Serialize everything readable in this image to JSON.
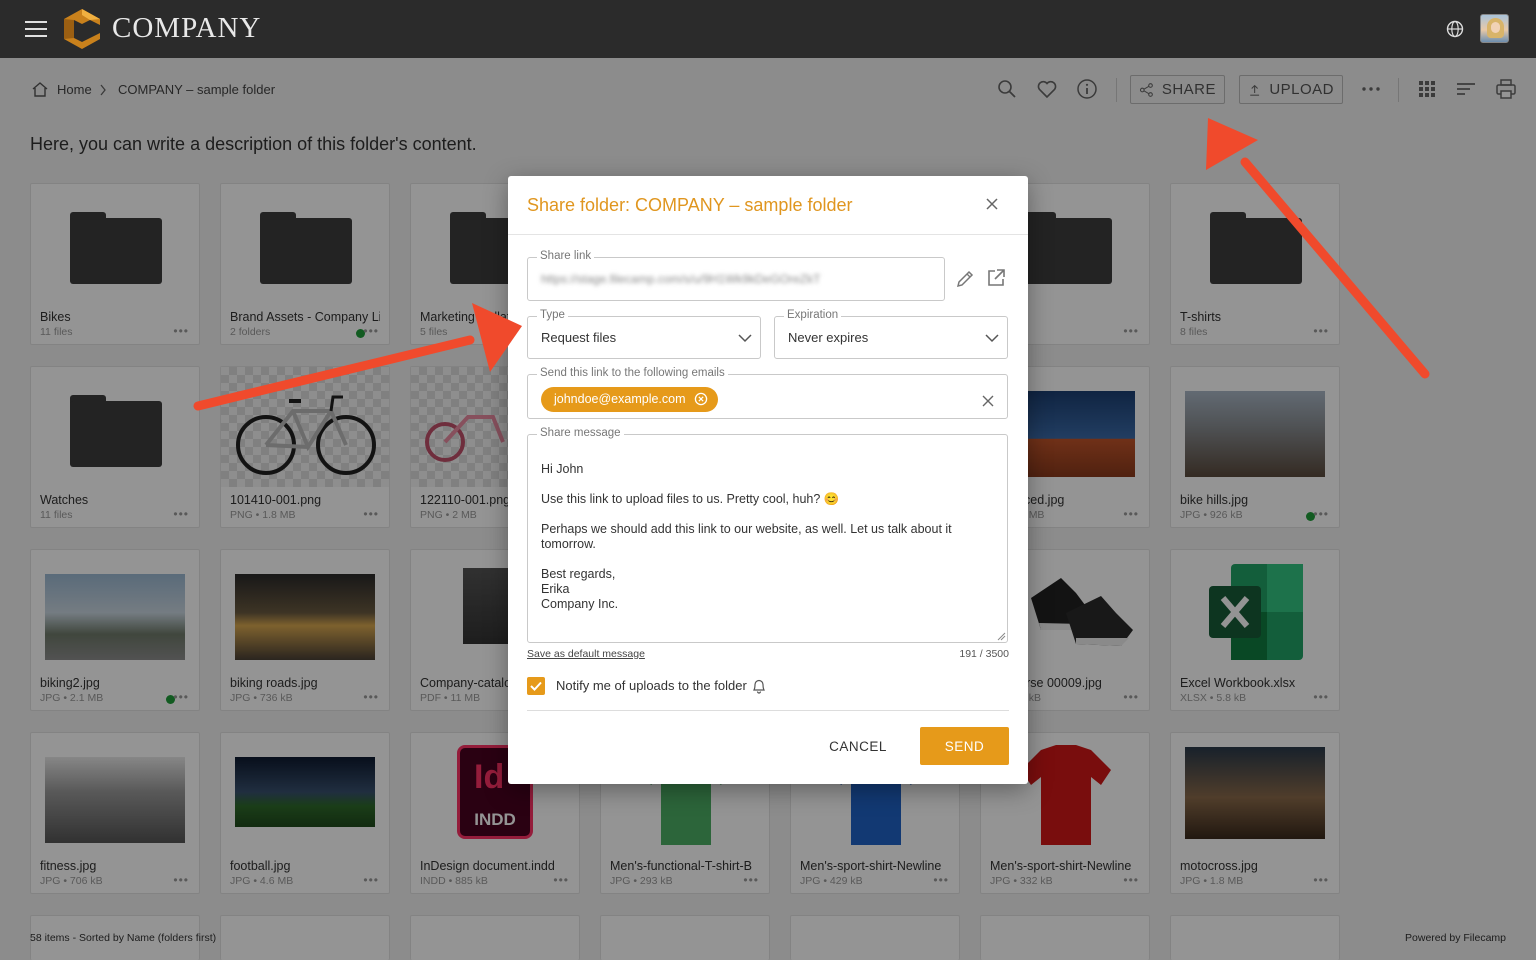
{
  "app": {
    "brand": "COMPANY"
  },
  "breadcrumb": {
    "home": "Home",
    "folder": "COMPANY – sample folder"
  },
  "toolbar": {
    "share_label": "SHARE",
    "upload_label": "UPLOAD"
  },
  "description": "Here, you can write a description of this folder's content.",
  "items": [
    {
      "name": "Bikes",
      "meta": "11 files"
    },
    {
      "name": "Brand Assets - Company Li",
      "meta": "2 folders"
    },
    {
      "name": "Marketing Collateral",
      "meta": "5 files"
    },
    {
      "name": "",
      "meta": ""
    },
    {
      "name": "",
      "meta": ""
    },
    {
      "name": "",
      "meta": ""
    },
    {
      "name": "T-shirts",
      "meta": "8 files"
    },
    {
      "name": "Watches",
      "meta": "11 files"
    },
    {
      "name": "101410-001.png",
      "meta": "PNG • 1.8 MB"
    },
    {
      "name": "122110-001.png",
      "meta": "PNG • 2 MB"
    },
    {
      "name": "",
      "meta": ""
    },
    {
      "name": "",
      "meta": ""
    },
    {
      "name": "advanced.jpg",
      "meta": "JPG • 1 MB"
    },
    {
      "name": "bike hills.jpg",
      "meta": "JPG • 926 kB"
    },
    {
      "name": "biking2.jpg",
      "meta": "JPG • 2.1 MB"
    },
    {
      "name": "biking roads.jpg",
      "meta": "JPG • 736 kB"
    },
    {
      "name": "Company-catalog.pdf",
      "meta": "PDF • 11 MB"
    },
    {
      "name": "",
      "meta": ""
    },
    {
      "name": "",
      "meta": ""
    },
    {
      "name": "Converse 00009.jpg",
      "meta": "JPG • 1 kB"
    },
    {
      "name": "Excel Workbook.xlsx",
      "meta": "XLSX • 5.8 kB"
    },
    {
      "name": "fitness.jpg",
      "meta": "JPG • 706 kB"
    },
    {
      "name": "football.jpg",
      "meta": "JPG • 4.6 MB"
    },
    {
      "name": "InDesign document.indd",
      "meta": "INDD • 885 kB"
    },
    {
      "name": "Men's-functional-T-shirt-B",
      "meta": "JPG • 293 kB"
    },
    {
      "name": "Men's-sport-shirt-Newline",
      "meta": "JPG • 429 kB"
    },
    {
      "name": "Men's-sport-shirt-Newline",
      "meta": "JPG • 332 kB"
    },
    {
      "name": "motocross.jpg",
      "meta": "JPG • 1.8 MB"
    }
  ],
  "indd_label": "INDD",
  "footer": {
    "left": "58 items - Sorted by Name (folders first)",
    "right": "Powered by Filecamp"
  },
  "modal": {
    "title": "Share folder: COMPANY – sample folder",
    "share_link_label": "Share link",
    "share_link_value": "https://stage.filecamp.com/s/u/9H1Wk9kDeGOreZkT",
    "type_label": "Type",
    "type_value": "Request files",
    "expiration_label": "Expiration",
    "expiration_value": "Never expires",
    "emails_label": "Send this link to the following emails",
    "email_chip": "johndoe@example.com",
    "message_label": "Share message",
    "message": "Hi John\n\nUse this link to upload files to us. Pretty cool, huh? 😊\n\nPerhaps we should add this link to our website, as well. Let us talk about it\ntomorrow.\n\nBest regards,\nErika\nCompany Inc.",
    "save_default": "Save as default message",
    "counter": "191 / 3500",
    "notify_label": "Notify me of uploads to the folder",
    "cancel": "CANCEL",
    "send": "SEND"
  },
  "colors": {
    "accent": "#e69a1a",
    "title": "#e0961f",
    "arrow": "#f04a2c",
    "topbar": "#2b2b2b"
  }
}
